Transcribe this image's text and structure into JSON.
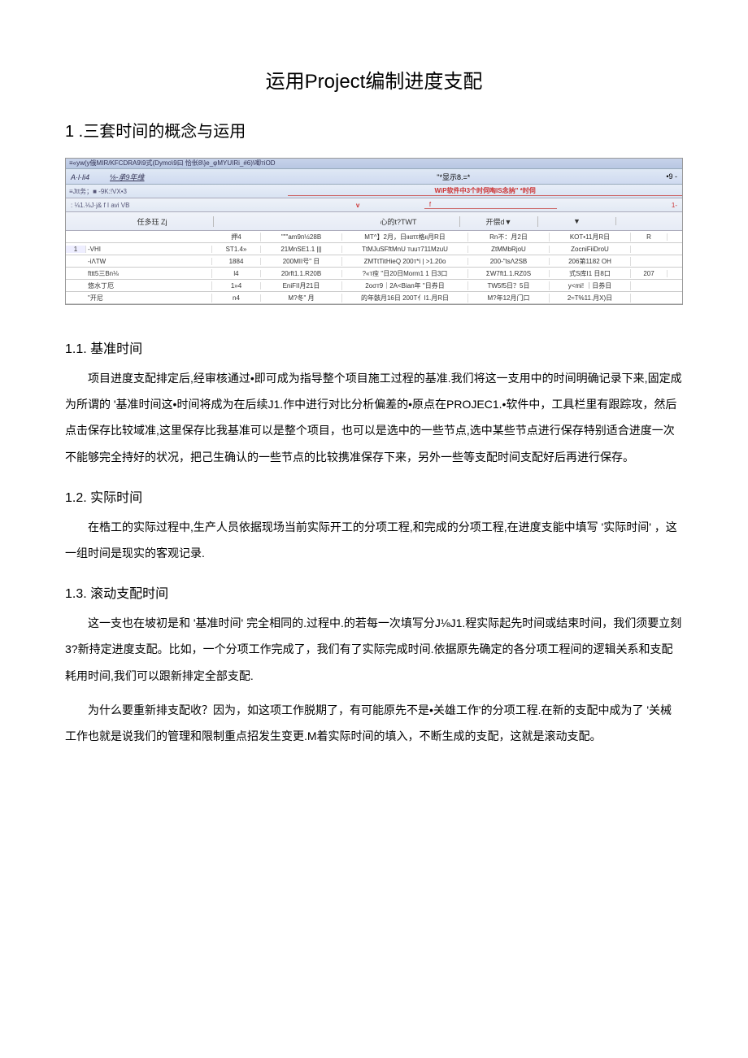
{
  "title": "运用Project编制进度支配",
  "section1": {
    "heading": "1 .三套时间的概念与运用",
    "sub11": "1.1.  基准时间",
    "p11a": "项目进度支配排定后,经审核通过•即可成为指导整个项目施工过程的基准.我们将这一支用中的时间明确记录下来,固定成为所谓的 '基准时间这•时间将成为在后续J1.作中进行对比分析偏差的•原点在PROJEC1.•软件中，工具栏里有跟踪攻，然后点击保存比较域准,这里保存比我基准可以是整个项目，也可以是选中的一些节点,选中某些节点进行保存特别适合进度一次不能够完全持好的状况，把己生确认的一些节点的比较携准保存下来，另外一些等支配时间支配好后再进行保存。",
    "sub12": "1.2.  实际时间",
    "p12a": "在梏工的实际过程中,生产人员依据现场当前实际开工的分项工程,和完成的分项工程,在进度支能中填写 '实际时间'  ，这一组时间是现实的客观记录.",
    "sub13": "1.3.  滚动支配时间",
    "p13a": "这一支也在坡初是和 '基准时间' 完全相同的.过程中.的若每一次填写分J⅛J1.程实际起先时间或结束时间，我们须要立刻3?新持定进度支配。比如，一个分项工作完成了，我们有了实际完成时间.依据原先确定的各分项工程间的逻辑关系和支配耗用时间,我们可以跟新排定全部支配.",
    "p13b": "为什么要重新排支配收？因为，如这项工作脱期了，有可能原先不是•关雄工作'的分项工程.在新的支配中成为了 '关械工作也就是说我们的管理和限制重点招发生变更.M着实际时间的填入，不断生成的支配，这就是滚动支配。"
  },
  "app": {
    "topband": "≡«yw(y俄MIR/KFCDRA9\\9式(Dymo\\9曰  恰伥8\\}e_φΜYUIRi_#6)\\唧тіOD",
    "header_left_a": "A·l·li4",
    "header_left_b": "⅛-承9年维",
    "header_center_label": "\"*显示8.=*",
    "header_right": "•9      -",
    "sub_left_a": "≡Jtt务；■    -9K:!VX•3",
    "sub_center_red": "WiP软件中3个时伺啕IS念抐\"  *时伺",
    "sub2_left": ": ⅛1.⅛J·j&    f I avi VB",
    "sub2_center": "v",
    "sub2_right_a": "f",
    "sub2_right_b": "1-",
    "colhdr": {
      "idx": "",
      "name": "任多珏               Zj",
      "dur": "",
      "a": "",
      "b": "心的t?TWT",
      "c": "开偿d▼",
      "d": "▼",
      "e": ""
    },
    "rows": [
      {
        "idx": "",
        "name": "",
        "dur": "押4",
        "a": "\"\"\"am9п½28B",
        "b": "MT^】2月，日ιιαττ格ιι月R日",
        "c": "Rn不：月2日",
        "d": "KOT•11月R日",
        "e": "R"
      },
      {
        "idx": "1",
        "name": "-VHI",
        "dur": "ST1.4»",
        "a": "21MnSE1.1 |||",
        "b": "TtMJuSFftMnU    тuuт711MzuU",
        "c": "ZtMMbRjoU",
        "d": "ZocniFiiDroU",
        "e": ""
      },
      {
        "idx": "",
        "name": "-iΛTW",
        "dur": "1884",
        "a": "200MII号\" 日",
        "b": "ZMTtTitHieQ   200т*i | >1.20o",
        "c": "200-\"tsΛ2SB",
        "d": "206第1182 OH",
        "e": ""
      },
      {
        "idx": "",
        "name": "fttt5三Bn⅛",
        "dur": "l4",
        "a": "20rft1.1.R20B",
        "b": "?«т痊 \"日20日Morm1 1 日3口",
        "c": "ΣW7ft1.1.RZ0S",
        "d": "式S库I1 日8口",
        "e": "207"
      },
      {
        "idx": "",
        "name": "悠水丁厄",
        "dur": "1»4",
        "a": "EniFII月21日",
        "b": "2οσт9｜2A<Bian年 \"日券日",
        "c": "ΤW5f5日？5日",
        "d": "y<mi! ｜日券日",
        "e": ""
      },
      {
        "idx": "",
        "name": "\"开尼",
        "dur": "n4",
        "a": "M?冬\"  月",
        "b": "的年骸月16日 200T亻I1.月R日",
        "c": "M?年12月门口",
        "d": "2≈T%11.月X)日",
        "e": ""
      }
    ]
  }
}
